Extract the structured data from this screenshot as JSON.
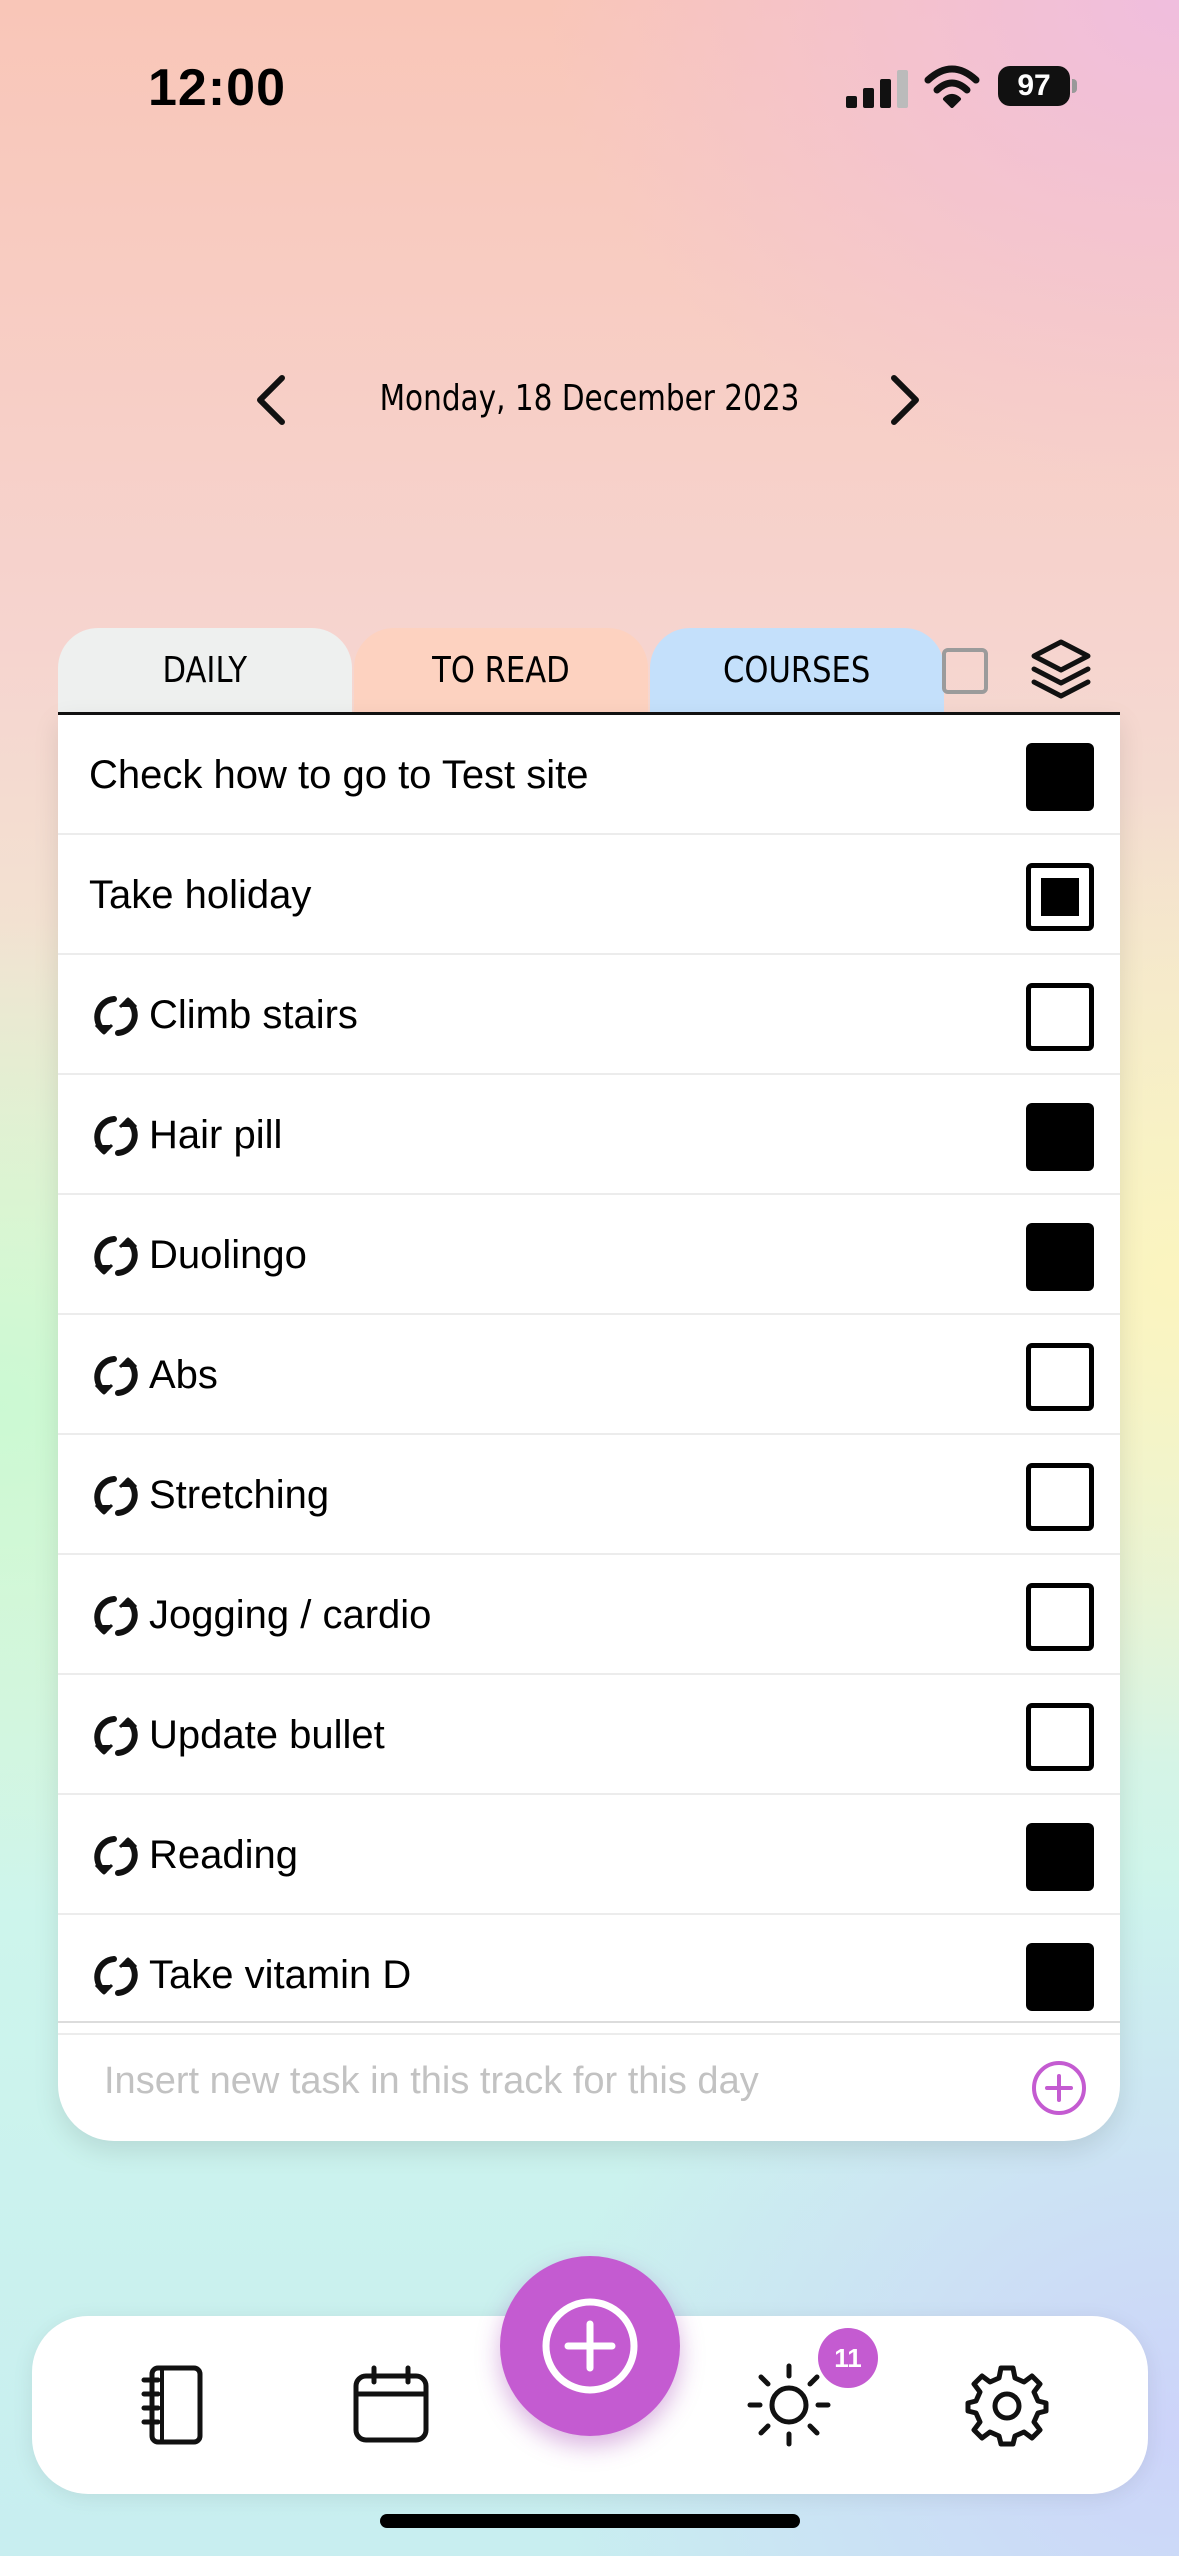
{
  "status_bar": {
    "time": "12:00",
    "battery": "97"
  },
  "date_nav": {
    "date": "Monday, 18 December 2023"
  },
  "tabs": [
    {
      "label": "DAILY"
    },
    {
      "label": "TO READ"
    },
    {
      "label": "COURSES"
    }
  ],
  "tasks": [
    {
      "label": "Check how to go to Test site",
      "repeat": false,
      "state": "done"
    },
    {
      "label": "Take holiday",
      "repeat": false,
      "state": "partial"
    },
    {
      "label": "Climb stairs",
      "repeat": true,
      "state": "empty"
    },
    {
      "label": "Hair pill",
      "repeat": true,
      "state": "done"
    },
    {
      "label": "Duolingo",
      "repeat": true,
      "state": "done"
    },
    {
      "label": "Abs",
      "repeat": true,
      "state": "empty"
    },
    {
      "label": "Stretching",
      "repeat": true,
      "state": "empty"
    },
    {
      "label": "Jogging / cardio",
      "repeat": true,
      "state": "empty"
    },
    {
      "label": "Update bullet",
      "repeat": true,
      "state": "empty"
    },
    {
      "label": "Reading",
      "repeat": true,
      "state": "done"
    },
    {
      "label": "Take vitamin D",
      "repeat": true,
      "state": "done"
    }
  ],
  "insert": {
    "placeholder": "Insert new task in this track for this day",
    "value": ""
  },
  "tab_bar": {
    "badge_count": "11"
  },
  "colors": {
    "accent": "#c45bd1",
    "tab_daily": "#eef0ef",
    "tab_to_read": "#fdd2c0",
    "tab_courses": "#c4e0fb"
  },
  "icons": [
    "signal-icon",
    "wifi-icon",
    "battery-icon",
    "chevron-left-icon",
    "chevron-right-icon",
    "checkbox-icon",
    "layers-icon",
    "repeat-icon",
    "add-circle-icon",
    "notebook-icon",
    "calendar-icon",
    "plus-circle-icon",
    "sun-icon",
    "gear-icon"
  ]
}
